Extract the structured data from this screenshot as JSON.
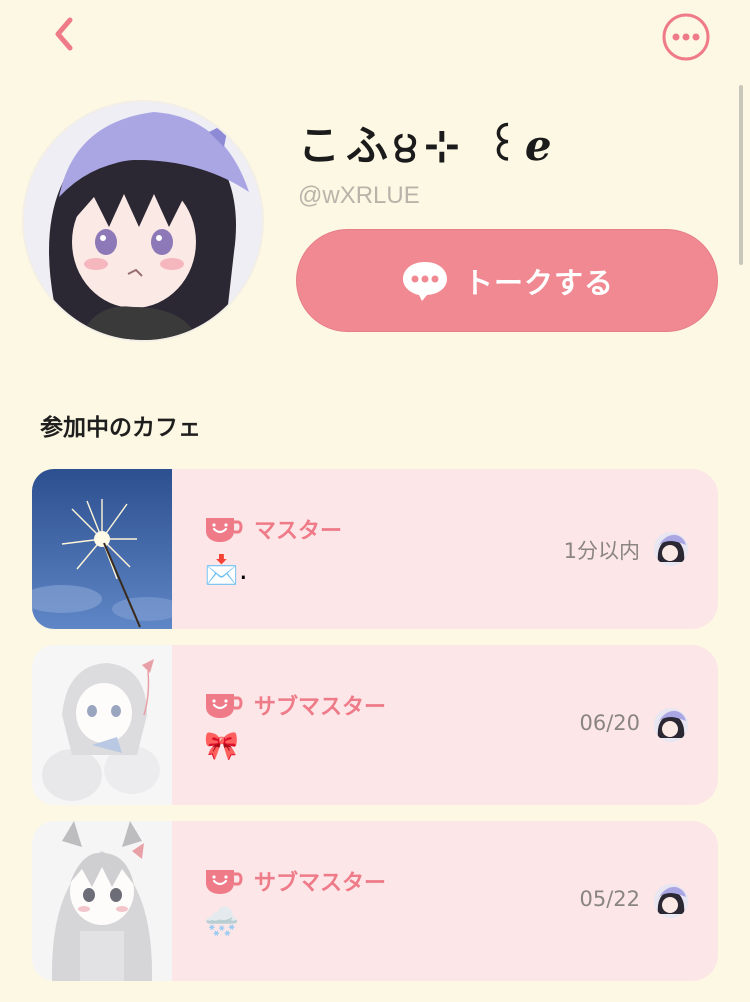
{
  "profile": {
    "name": "こふ੪⊹ ꒰ℯ",
    "handle": "@wXRLUE",
    "talk_button_label": "トークする"
  },
  "section": {
    "title": "参加中のカフェ"
  },
  "cafes": [
    {
      "role": "マスター",
      "description": "📩.",
      "time": "1分以内"
    },
    {
      "role": "サブマスター",
      "description": "🎀",
      "time": "06/20"
    },
    {
      "role": "サブマスター",
      "description": "🌨️",
      "time": "05/22"
    }
  ],
  "colors": {
    "background": "#fdf8e3",
    "accent_pink": "#f08991",
    "card_bg": "#fce6e8",
    "role_text": "#ef7b88"
  },
  "icons": {
    "back": "chevron-left-icon",
    "more": "more-dots-icon",
    "talk": "speech-bubble-icon",
    "role": "cup-icon"
  }
}
